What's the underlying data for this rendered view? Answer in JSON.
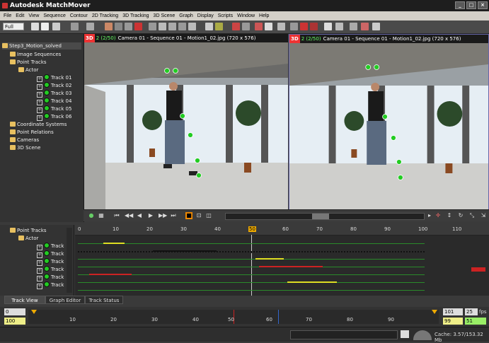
{
  "app": {
    "title": "Autodesk MatchMover"
  },
  "menu": [
    "File",
    "Edit",
    "View",
    "Sequence",
    "Contour",
    "2D Tracking",
    "3D Tracking",
    "3D Scene",
    "Graph",
    "Display",
    "Scripts",
    "Window",
    "Help"
  ],
  "toolbar": {
    "zoom_value": "Full"
  },
  "tree": {
    "root": "Step3_Motion_solved",
    "items": [
      "Image Sequences",
      "Point Tracks",
      "Actor",
      "Track 01",
      "Track 02",
      "Track 03",
      "Track 04",
      "Track 05",
      "Track 06",
      "Coordinate Systems",
      "Point Relations",
      "Cameras",
      "3D Scene"
    ]
  },
  "viewports": {
    "left": {
      "badge": "3D",
      "frame": "2 (2/50)",
      "caption": "Camera 01 - Sequence 01 - Motion1_02.jpg (720 x 576)"
    },
    "right": {
      "badge": "3D",
      "frame": "2 (2/50)",
      "caption": "Camera 01 - Sequence 01 - Motion1_02.jpg (720 x 576)"
    }
  },
  "trackview": {
    "tree": [
      "Point Tracks",
      "Actor",
      "Track",
      "Track",
      "Track",
      "Track",
      "Track",
      "Track"
    ],
    "ruler": [
      "0",
      "10",
      "20",
      "30",
      "40",
      "50",
      "60",
      "70",
      "80",
      "90",
      "100",
      "110"
    ]
  },
  "tabs": [
    "Track View",
    "Graph Editor",
    "Track Status"
  ],
  "timeline": {
    "start": "0",
    "start_value": "100",
    "ticks": [
      "10",
      "20",
      "30",
      "40",
      "50",
      "60",
      "70",
      "80",
      "90"
    ],
    "end": "101",
    "end_value": "99",
    "fps_value": "25",
    "fps_label": "fps",
    "current": "51"
  },
  "status": {
    "cache": "Cache: 3.57/153.32 Mb"
  },
  "colors": {
    "accent_green": "#22cc22",
    "track_red": "#cc2222",
    "track_yellow": "#dddd22"
  }
}
